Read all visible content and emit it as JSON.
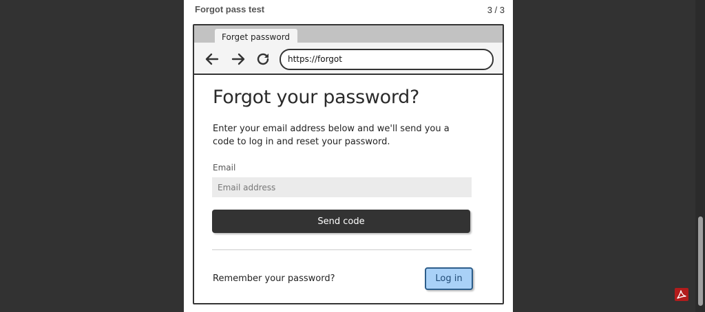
{
  "page": {
    "title": "Forgot pass test",
    "counter": "3 / 3"
  },
  "browser": {
    "tab_label": "Forget password",
    "url": "https://forgot",
    "back_icon": "arrow-left-icon",
    "forward_icon": "arrow-right-icon",
    "reload_icon": "reload-icon"
  },
  "form": {
    "heading": "Forgot your password?",
    "description": "Enter your email address below and we'll send you a\n code to log in and reset your password.",
    "email_label": "Email",
    "email_placeholder": "Email address",
    "email_value": "",
    "send_button": "Send code",
    "remember_text": "Remember your password?",
    "login_button": "Log in"
  },
  "colors": {
    "viewer_background": "#323232",
    "primary_button": "#333333",
    "login_button": "#a9d1f7",
    "login_border": "#2c5d8a",
    "pdf_icon": "#b21c1c"
  },
  "viewer": {
    "pdf_icon": "pdf-icon"
  }
}
